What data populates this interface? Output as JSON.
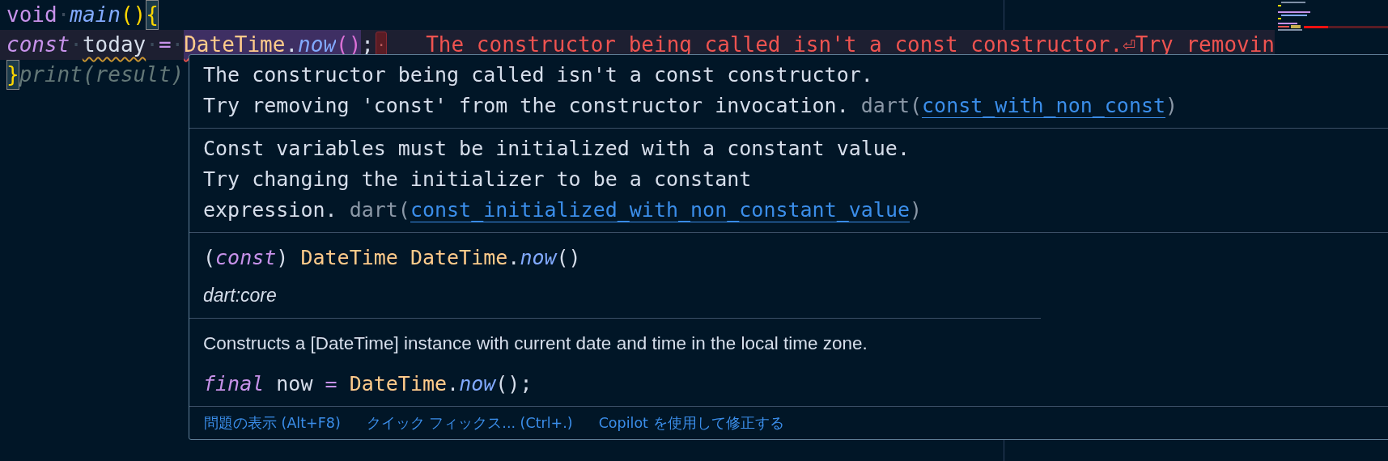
{
  "editor": {
    "lines": [
      {
        "tokens": [
          {
            "kind": "storage",
            "text": "void"
          },
          {
            "kind": "ws",
            "text": "·"
          },
          {
            "kind": "function",
            "text": "main"
          },
          {
            "kind": "bracket1",
            "text": "()"
          },
          {
            "kind": "bracket1",
            "text": "{",
            "bracket_match": true
          }
        ]
      },
      {
        "highlighted": true,
        "tokens": [
          {
            "kind": "keyword",
            "text": "const"
          },
          {
            "kind": "ws",
            "text": "·"
          },
          {
            "kind": "variable",
            "text": "today",
            "warning_squiggle": true
          },
          {
            "kind": "ws",
            "text": "·"
          },
          {
            "kind": "operator",
            "text": "="
          },
          {
            "kind": "ws",
            "text": "·"
          },
          {
            "kind": "type",
            "text": "DateTime",
            "error_squiggle": true,
            "selected": true
          },
          {
            "kind": "punct",
            "text": ".",
            "error_squiggle": true,
            "selected": true
          },
          {
            "kind": "function",
            "text": "now",
            "error_squiggle": true,
            "selected": true
          },
          {
            "kind": "bracket2",
            "text": "()",
            "error_squiggle": true,
            "selected": true
          },
          {
            "kind": "punct",
            "text": ";"
          },
          {
            "kind": "marker",
            "text": "·"
          },
          {
            "kind": "inline_error",
            "text": "The constructor being called isn't a const constructor.⏎Try removin"
          }
        ]
      },
      {
        "tokens": [
          {
            "kind": "bracket1",
            "text": "}",
            "bracket_match": true
          },
          {
            "kind": "ghost",
            "text": "print(result)"
          }
        ]
      }
    ]
  },
  "hover": {
    "problems": [
      {
        "message": "The constructor being called isn't a const constructor.\nTry removing 'const' from the constructor invocation. ",
        "source": "dart(",
        "code": "const_with_non_const",
        "close": ")"
      },
      {
        "message": "Const variables must be initialized with a constant value.\nTry changing the initializer to be a constant\nexpression. ",
        "source": "dart(",
        "code": "const_initialized_with_non_constant_value",
        "close": ")"
      }
    ],
    "signature": [
      {
        "kind": "punct",
        "text": "("
      },
      {
        "kind": "keyword",
        "text": "const"
      },
      {
        "kind": "punct",
        "text": ") "
      },
      {
        "kind": "type",
        "text": "DateTime DateTime"
      },
      {
        "kind": "punct",
        "text": "."
      },
      {
        "kind": "function",
        "text": "now"
      },
      {
        "kind": "punct",
        "text": "()"
      }
    ],
    "library": "dart:core",
    "doc": "Constructs a [DateTime] instance with current date and time in the local time zone.",
    "example": [
      {
        "kind": "keyword",
        "text": "final"
      },
      {
        "kind": "punct",
        "text": " now "
      },
      {
        "kind": "operator",
        "text": "="
      },
      {
        "kind": "type",
        "text": " DateTime"
      },
      {
        "kind": "punct",
        "text": "."
      },
      {
        "kind": "function",
        "text": "now"
      },
      {
        "kind": "punct",
        "text": "();"
      }
    ],
    "actions": [
      "問題の表示 (Alt+F8)",
      "クイック フィックス... (Ctrl+.)",
      "Copilot を使用して修正する"
    ]
  }
}
